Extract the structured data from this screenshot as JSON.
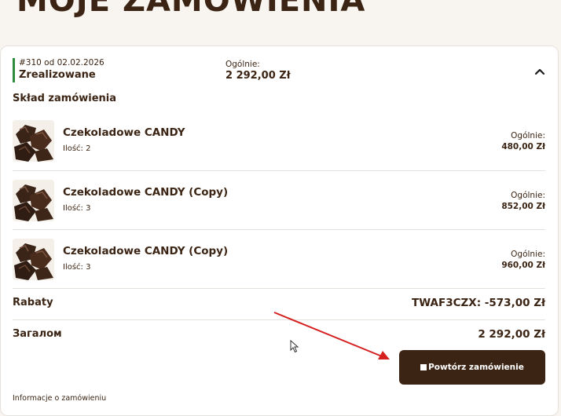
{
  "page": {
    "title": "MOJE ZAMÓWIENIA"
  },
  "order": {
    "number_date": "#310 od 02.02.2026",
    "status": "Zrealizowane",
    "total_label": "Ogólnie:",
    "total_value": "2 292,00 Zł"
  },
  "items_section": {
    "title": "Skład zamówienia"
  },
  "items": [
    {
      "name": "Czekoladowe CANDY",
      "qty": "Ilość: 2",
      "total_label": "Ogólnie:",
      "total_value": "480,00 Zł"
    },
    {
      "name": "Czekoladowe CANDY (Copy)",
      "qty": "Ilość: 3",
      "total_label": "Ogólnie:",
      "total_value": "852,00 Zł"
    },
    {
      "name": "Czekoladowe CANDY (Copy)",
      "qty": "Ilość: 3",
      "total_label": "Ogólnie:",
      "total_value": "960,00 Zł"
    }
  ],
  "discounts": {
    "label": "Rabaty",
    "value": "TWAF3CZX: -573,00 Zł"
  },
  "sum": {
    "label": "Загалом",
    "value": "2 292,00 Zł"
  },
  "actions": {
    "repeat_label": "Powtórz zamówienie"
  },
  "footer": {
    "info_label": "Informacje o zamówieniu"
  },
  "colors": {
    "brand": "#3b2413",
    "status_bar": "#2e8b3c",
    "annotation": "#d62020"
  },
  "icons": {
    "collapse": "chevron-up-icon",
    "button_square": "square-icon",
    "cursor": "mouse-pointer-icon"
  }
}
